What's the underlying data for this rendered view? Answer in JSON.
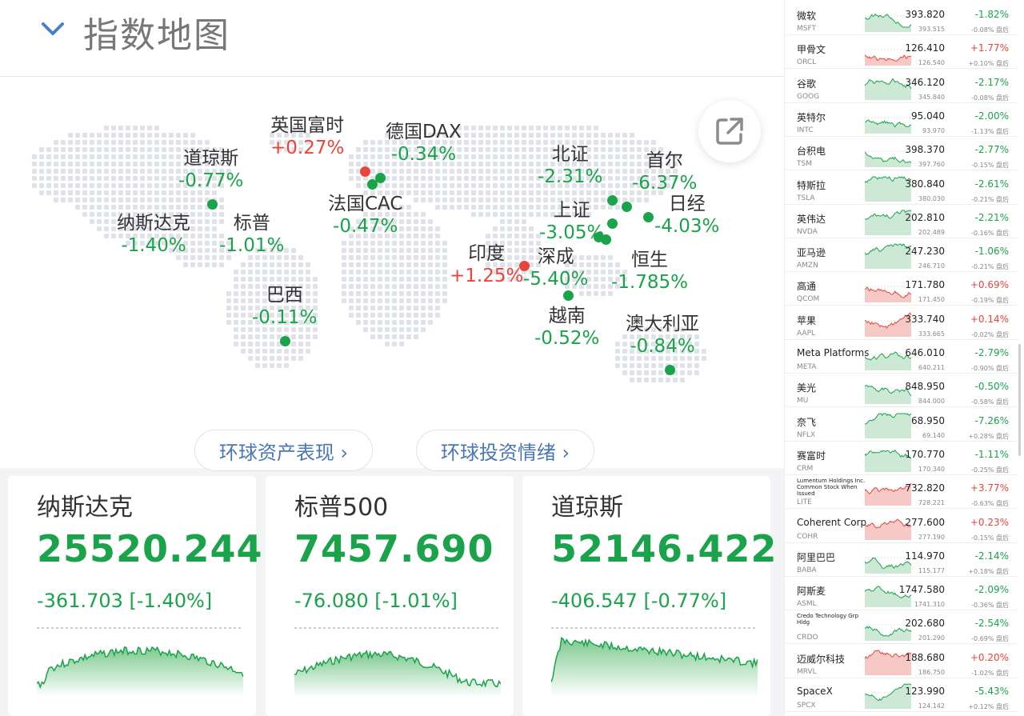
{
  "header": {
    "title": "指数地图"
  },
  "map": {
    "dot_color": "#dfe2e8",
    "indices": [
      {
        "id": "ftse",
        "name": "英国富时",
        "change": "+0.27%",
        "dir": "up"
      },
      {
        "id": "dax",
        "name": "德国DAX",
        "change": "-0.34%",
        "dir": "down"
      },
      {
        "id": "dow",
        "name": "道琼斯",
        "change": "-0.77%",
        "dir": "down"
      },
      {
        "id": "cac",
        "name": "法国CAC",
        "change": "-0.47%",
        "dir": "down"
      },
      {
        "id": "nasdaq",
        "name": "纳斯达克",
        "change": "-1.40%",
        "dir": "down"
      },
      {
        "id": "sp",
        "name": "标普",
        "change": "-1.01%",
        "dir": "down"
      },
      {
        "id": "brazil",
        "name": "巴西",
        "change": "-0.11%",
        "dir": "down"
      },
      {
        "id": "beizheng",
        "name": "北证",
        "change": "-2.31%",
        "dir": "down"
      },
      {
        "id": "seoul",
        "name": "首尔",
        "change": "-6.37%",
        "dir": "down"
      },
      {
        "id": "shanghai",
        "name": "上证",
        "change": "-3.05%",
        "dir": "down"
      },
      {
        "id": "nikkei",
        "name": "日经",
        "change": "-4.03%",
        "dir": "down"
      },
      {
        "id": "india",
        "name": "印度",
        "change": "+1.25%",
        "dir": "up"
      },
      {
        "id": "shenzhen",
        "name": "深成",
        "change": "-5.40%",
        "dir": "down"
      },
      {
        "id": "hangseng",
        "name": "恒生",
        "change": "-1.785%",
        "dir": "down"
      },
      {
        "id": "vietnam",
        "name": "越南",
        "change": "-0.52%",
        "dir": "down"
      },
      {
        "id": "australia",
        "name": "澳大利亚",
        "change": "-0.84%",
        "dir": "down"
      }
    ]
  },
  "pills": {
    "global_assets": "环球资产表现 ›",
    "global_sentiment": "环球投资情绪 ›"
  },
  "cards": [
    {
      "name": "纳斯达克",
      "price": "25520.244",
      "change": "-361.703 [-1.40%]",
      "trend": "down"
    },
    {
      "name": "标普500",
      "price": "7457.690",
      "change": "-76.080 [-1.01%]",
      "trend": "down"
    },
    {
      "name": "道琼斯",
      "price": "52146.422",
      "change": "-406.547 [-0.77%]",
      "trend": "down"
    }
  ],
  "colors": {
    "up": "#e8453c",
    "down": "#1aa34a",
    "link": "#4a76b8"
  },
  "stocks": [
    {
      "name": "微软",
      "code": "MSFT",
      "price": "393.820",
      "ah_price": "393.515",
      "change": "-1.82%",
      "ah_change": "-0.08% 盘后",
      "dir": "down"
    },
    {
      "name": "甲骨文",
      "code": "ORCL",
      "price": "126.410",
      "ah_price": "126.540",
      "change": "+1.77%",
      "ah_change": "+0.10% 盘后",
      "dir": "up"
    },
    {
      "name": "谷歌",
      "code": "GOOG",
      "price": "346.120",
      "ah_price": "345.840",
      "change": "-2.17%",
      "ah_change": "-0.08% 盘后",
      "dir": "down"
    },
    {
      "name": "英特尔",
      "code": "INTC",
      "price": "95.040",
      "ah_price": "93.970",
      "change": "-2.00%",
      "ah_change": "-1.13% 盘后",
      "dir": "down"
    },
    {
      "name": "台积电",
      "code": "TSM",
      "price": "398.370",
      "ah_price": "397.760",
      "change": "-2.77%",
      "ah_change": "-0.15% 盘后",
      "dir": "down"
    },
    {
      "name": "特斯拉",
      "code": "TSLA",
      "price": "380.840",
      "ah_price": "380.030",
      "change": "-2.61%",
      "ah_change": "-0.21% 盘后",
      "dir": "down"
    },
    {
      "name": "英伟达",
      "code": "NVDA",
      "price": "202.810",
      "ah_price": "202.489",
      "change": "-2.21%",
      "ah_change": "-0.16% 盘后",
      "dir": "down"
    },
    {
      "name": "亚马逊",
      "code": "AMZN",
      "price": "247.230",
      "ah_price": "246.710",
      "change": "-1.06%",
      "ah_change": "-0.21% 盘后",
      "dir": "down"
    },
    {
      "name": "高通",
      "code": "QCOM",
      "price": "171.780",
      "ah_price": "171.450",
      "change": "+0.69%",
      "ah_change": "-0.19% 盘后",
      "dir": "up"
    },
    {
      "name": "苹果",
      "code": "AAPL",
      "price": "333.740",
      "ah_price": "333.665",
      "change": "+0.14%",
      "ah_change": "-0.02% 盘后",
      "dir": "up"
    },
    {
      "name": "Meta Platforms",
      "code": "META",
      "price": "646.010",
      "ah_price": "640.211",
      "change": "-2.79%",
      "ah_change": "-0.90% 盘后",
      "dir": "down"
    },
    {
      "name": "美光",
      "code": "MU",
      "price": "848.950",
      "ah_price": "844.000",
      "change": "-0.50%",
      "ah_change": "-0.58% 盘后",
      "dir": "down"
    },
    {
      "name": "奈飞",
      "code": "NFLX",
      "price": "68.950",
      "ah_price": "69.140",
      "change": "-7.26%",
      "ah_change": "+0.28% 盘后",
      "dir": "down"
    },
    {
      "name": "赛富时",
      "code": "CRM",
      "price": "170.770",
      "ah_price": "170.340",
      "change": "-1.11%",
      "ah_change": "-0.25% 盘后",
      "dir": "down"
    },
    {
      "name": "Lumentum Holdings Inc. Common Stock When Issued",
      "code": "LITE",
      "price": "732.820",
      "ah_price": "728.221",
      "change": "+3.77%",
      "ah_change": "-0.63% 盘后",
      "dir": "up",
      "small": true
    },
    {
      "name": "Coherent Corp",
      "code": "COHR",
      "price": "277.600",
      "ah_price": "277.190",
      "change": "+0.23%",
      "ah_change": "-0.15% 盘后",
      "dir": "up"
    },
    {
      "name": "阿里巴巴",
      "code": "BABA",
      "price": "114.970",
      "ah_price": "115.177",
      "change": "-2.14%",
      "ah_change": "+0.18% 盘后",
      "dir": "down"
    },
    {
      "name": "阿斯麦",
      "code": "ASML",
      "price": "1747.580",
      "ah_price": "1741.310",
      "change": "-2.09%",
      "ah_change": "-0.36% 盘后",
      "dir": "down"
    },
    {
      "name": "Credo Technology Grp Hldg",
      "code": "CRDO",
      "price": "202.680",
      "ah_price": "201.290",
      "change": "-2.54%",
      "ah_change": "-0.69% 盘后",
      "dir": "down",
      "small": true
    },
    {
      "name": "迈威尔科技",
      "code": "MRVL",
      "price": "188.680",
      "ah_price": "186.750",
      "change": "+0.20%",
      "ah_change": "-1.02% 盘后",
      "dir": "up"
    },
    {
      "name": "SpaceX",
      "code": "SPCX",
      "price": "123.990",
      "ah_price": "124.142",
      "change": "-5.43%",
      "ah_change": "+0.12% 盘后",
      "dir": "down"
    }
  ]
}
